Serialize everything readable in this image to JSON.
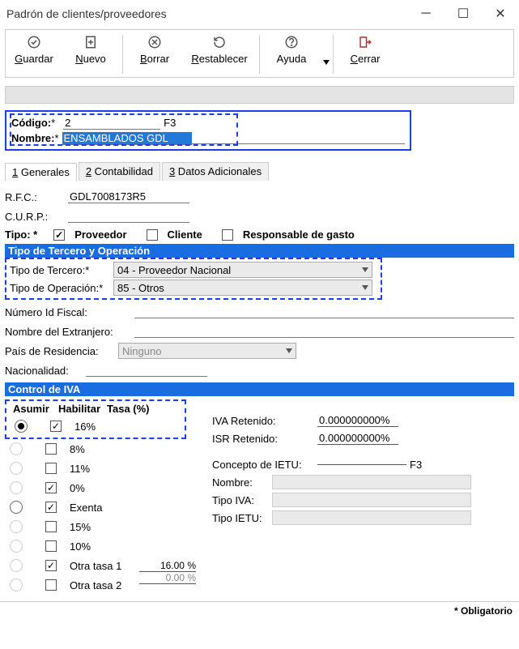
{
  "window": {
    "title": "Padrón de clientes/proveedores"
  },
  "toolbar": {
    "guardar": "uardar",
    "nuevo": "uevo",
    "borrar": "orrar",
    "restablecer": "establecer",
    "ayuda": "Ayuda",
    "cerrar": "errar"
  },
  "codigo": {
    "label": "Código:",
    "req": "*",
    "value": "2",
    "hint": "F3",
    "nombre_label": "Nombre:",
    "nombre_value": "ENSAMBLADOS GDL"
  },
  "tabs": {
    "t1": " Generales",
    "t2": " Contabilidad",
    "t3": " Datos Adicionales"
  },
  "generales": {
    "rfc_label": "R.F.C.:",
    "rfc_value": "GDL7008173R5",
    "curp_label": "C.U.R.P.:",
    "curp_value": "",
    "tipo_label": "Tipo: *",
    "proveedor": "Proveedor",
    "cliente": "Cliente",
    "responsable": "Responsable de gasto"
  },
  "tercero": {
    "section": "Tipo de Tercero y Operación",
    "tipo_tercero_label": "Tipo de Tercero:*",
    "tipo_tercero_value": "04 - Proveedor Nacional",
    "tipo_operacion_label": "Tipo de Operación:*",
    "tipo_operacion_value": "85 - Otros",
    "num_id_label": "Número Id Fiscal:",
    "nom_ext_label": "Nombre del Extranjero:",
    "pais_label": "País de Residencia:",
    "pais_value": "Ninguno",
    "nacionalidad_label": "Nacionalidad:"
  },
  "iva": {
    "section": "Control de IVA",
    "asumir": "Asumir",
    "habilitar": "Habilitar",
    "tasa": "Tasa (%)",
    "r16": "16%",
    "r8": "8%",
    "r11": "11%",
    "r0": "0%",
    "rex": "Exenta",
    "r15": "15%",
    "r10": "10%",
    "rot1": "Otra tasa 1",
    "rot2": "Otra tasa 2",
    "ot1v": "16.00 %",
    "ot2v": "0.00 %"
  },
  "retenidos": {
    "iva_ret_label": "IVA Retenido:",
    "iva_ret_value": "0.000000000%",
    "isr_ret_label": "ISR Retenido:",
    "isr_ret_value": "0.000000000%",
    "concepto_label": "Concepto de IETU:",
    "concepto_hint": "F3",
    "nombre_label": "Nombre:",
    "tipo_iva_label": "Tipo IVA:",
    "tipo_ietu_label": "Tipo IETU:"
  },
  "footer": {
    "obligatorio": "* Obligatorio"
  }
}
